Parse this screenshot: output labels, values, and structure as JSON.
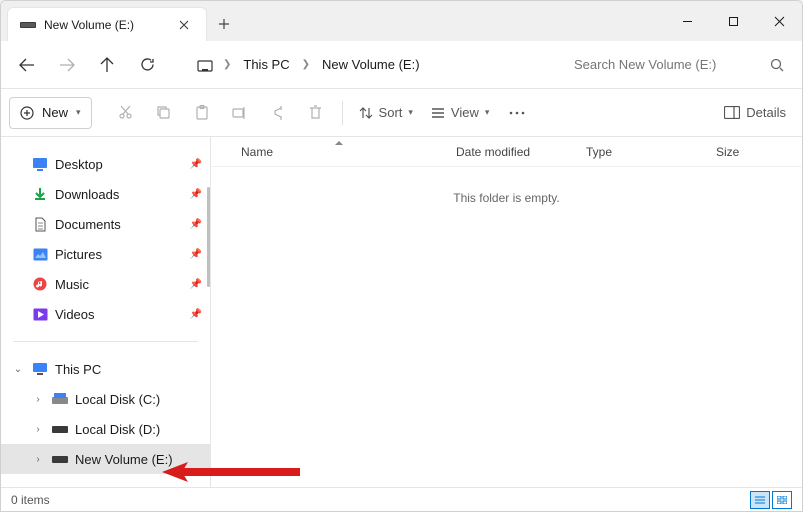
{
  "tab": {
    "title": "New Volume (E:)"
  },
  "breadcrumb": {
    "home_icon": "monitor",
    "items": [
      "This PC",
      "New Volume (E:)"
    ]
  },
  "search": {
    "placeholder": "Search New Volume (E:)"
  },
  "toolbar": {
    "new_label": "New",
    "sort_label": "Sort",
    "view_label": "View",
    "details_label": "Details"
  },
  "sidebar": {
    "quick": [
      {
        "label": "Desktop",
        "icon": "desktop"
      },
      {
        "label": "Downloads",
        "icon": "downloads"
      },
      {
        "label": "Documents",
        "icon": "documents"
      },
      {
        "label": "Pictures",
        "icon": "pictures"
      },
      {
        "label": "Music",
        "icon": "music"
      },
      {
        "label": "Videos",
        "icon": "videos"
      }
    ],
    "thispc": {
      "label": "This PC"
    },
    "drives": [
      {
        "label": "Local Disk (C:)"
      },
      {
        "label": "Local Disk (D:)"
      },
      {
        "label": "New Volume (E:)"
      }
    ]
  },
  "columns": {
    "name": "Name",
    "date": "Date modified",
    "type": "Type",
    "size": "Size"
  },
  "content": {
    "empty_message": "This folder is empty."
  },
  "status": {
    "items_text": "0 items"
  }
}
